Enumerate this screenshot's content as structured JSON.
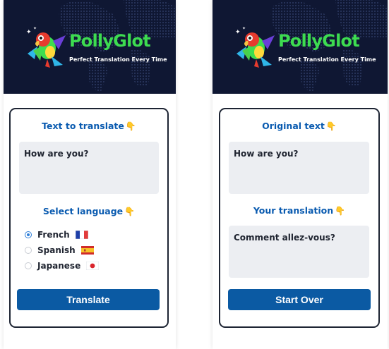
{
  "app": {
    "title": "PollyGlot",
    "tagline": "Perfect Translation Every Time",
    "colors": {
      "header_bg": "#0f1733",
      "brand_green": "#3ddc50",
      "accent_blue": "#0a5bb0",
      "button_blue": "#0b5aa3"
    }
  },
  "translate_view": {
    "text_heading": "Text to translate",
    "input_value": "How are you?",
    "language_heading": "Select language",
    "languages": [
      {
        "label": "French",
        "flag": "france-flag-icon",
        "selected": true
      },
      {
        "label": "Spanish",
        "flag": "spain-flag-icon",
        "selected": false
      },
      {
        "label": "Japanese",
        "flag": "japan-flag-icon",
        "selected": false
      }
    ],
    "button_label": "Translate"
  },
  "result_view": {
    "original_heading": "Original text",
    "original_value": "How are you?",
    "translation_heading": "Your translation",
    "translation_value": "Comment allez-vous?",
    "button_label": "Start Over"
  },
  "icons": {
    "hand": "pointing-down-hand-icon",
    "logo": "parrot-logo-icon"
  }
}
